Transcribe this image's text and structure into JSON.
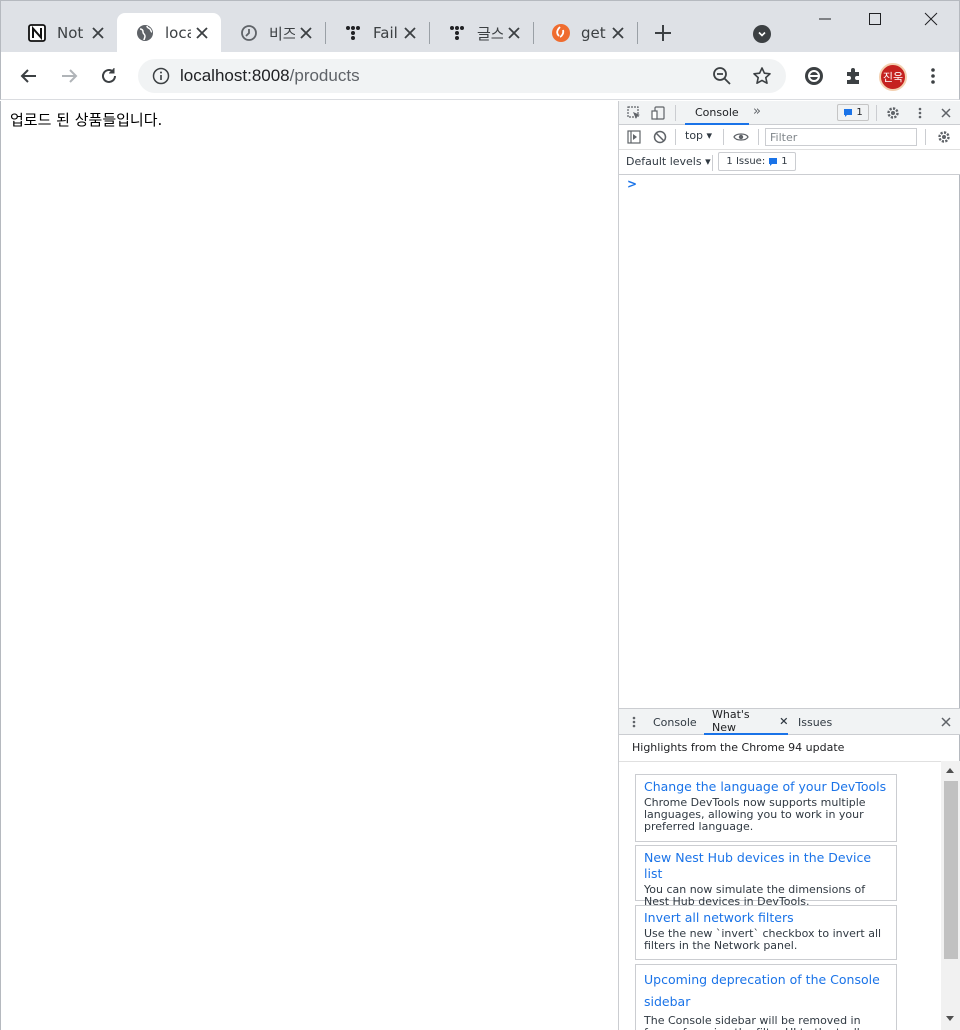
{
  "tabs": [
    {
      "title": "Not",
      "icon": "notion-icon"
    },
    {
      "title": "loca",
      "icon": "globe-icon"
    },
    {
      "title": "비즈",
      "icon": "clock-icon"
    },
    {
      "title": "Fail",
      "icon": "dots-icon"
    },
    {
      "title": "글스",
      "icon": "dots-icon"
    },
    {
      "title": "get",
      "icon": "codeigniter-icon"
    }
  ],
  "address_bar": {
    "host": "localhost:8008",
    "path": "/products"
  },
  "profile": {
    "initials": "진욱"
  },
  "page": {
    "text": "업로드 된 상품들입니다."
  },
  "devtools": {
    "main_tab": "Console",
    "issue_badge_count": "1",
    "context": "top",
    "filter_placeholder": "Filter",
    "levels": "Default levels",
    "issues_label": "1 Issue:",
    "issues_count": "1",
    "prompt": ">",
    "drawer_tabs": [
      "Console",
      "What's New",
      "Issues"
    ],
    "highlights": "Highlights from the Chrome 94 update",
    "cards": [
      {
        "title": "Change the language of your DevTools",
        "text": "Chrome DevTools now supports multiple languages, allowing you to work in your preferred language."
      },
      {
        "title": "New Nest Hub devices in the Device list",
        "text": "You can now simulate the dimensions of Nest Hub devices in DevTools."
      },
      {
        "title": "Invert all network filters",
        "text": "Use the new `invert` checkbox to invert all filters in the Network panel."
      },
      {
        "title": "Upcoming deprecation of the Console sidebar",
        "text": "The Console sidebar will be removed in favor of moving the filter UI to the toolbar."
      }
    ]
  },
  "colors": {
    "accent": "#1a73e8",
    "avatar": "#c5221f",
    "codeigniter": "#ef6c2f"
  }
}
